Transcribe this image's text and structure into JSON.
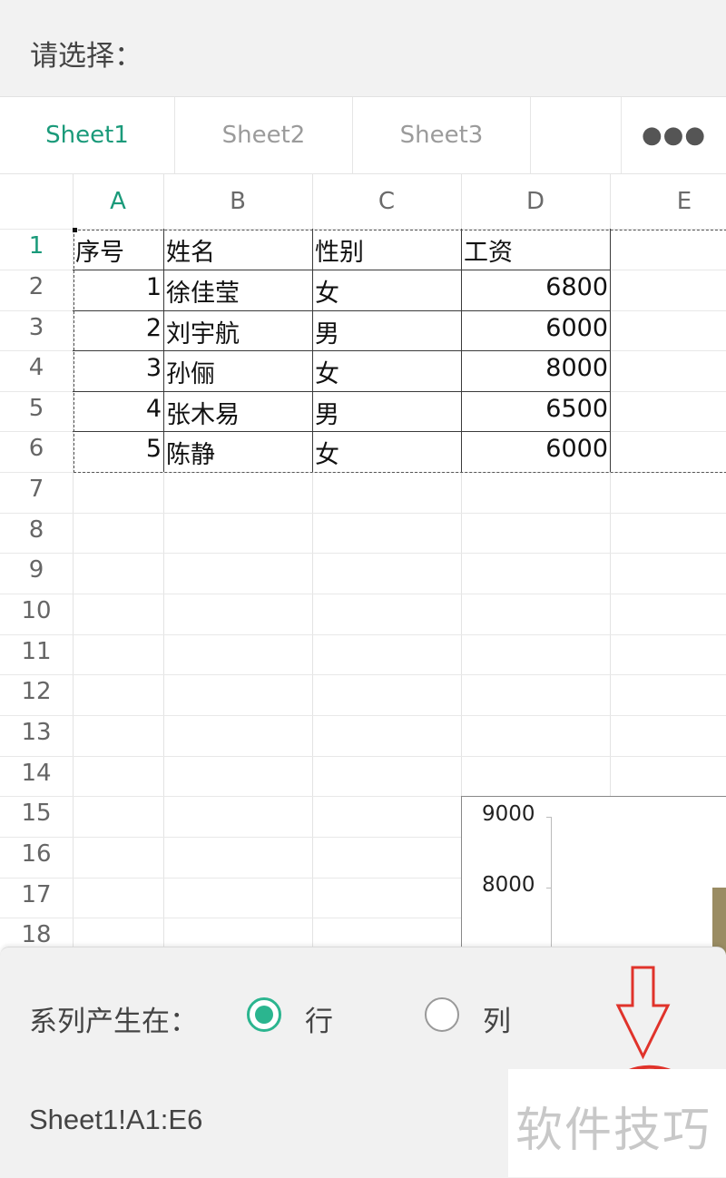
{
  "header": {
    "title": "请选择："
  },
  "tabs": [
    {
      "label": "Sheet1",
      "active": true
    },
    {
      "label": "Sheet2",
      "active": false
    },
    {
      "label": "Sheet3",
      "active": false
    }
  ],
  "more_icon": "more-horizontal-icon",
  "columns": [
    "A",
    "B",
    "C",
    "D",
    "E"
  ],
  "rows": [
    "1",
    "2",
    "3",
    "4",
    "5",
    "6",
    "7",
    "8",
    "9",
    "10",
    "11",
    "12",
    "13",
    "14",
    "15",
    "16",
    "17",
    "18"
  ],
  "table": {
    "header": [
      "序号",
      "姓名",
      "性别",
      "工资"
    ],
    "rows": [
      [
        "1",
        "徐佳莹",
        "女",
        "6800"
      ],
      [
        "2",
        "刘宇航",
        "男",
        "6000"
      ],
      [
        "3",
        "孙俪",
        "女",
        "8000"
      ],
      [
        "4",
        "张木易",
        "男",
        "6500"
      ],
      [
        "5",
        "陈静",
        "女",
        "6000"
      ]
    ]
  },
  "chart": {
    "ticks": [
      "9000",
      "8000"
    ]
  },
  "panel": {
    "series_label": "系列产生在：",
    "options": [
      {
        "label": "行",
        "selected": true
      },
      {
        "label": "列",
        "selected": false
      }
    ],
    "range": "Sheet1!A1:E6"
  },
  "watermark": "软件技巧",
  "colors": {
    "accent": "#1a9a7a",
    "radio": "#2bb58f",
    "annotation": "#e0332b"
  }
}
